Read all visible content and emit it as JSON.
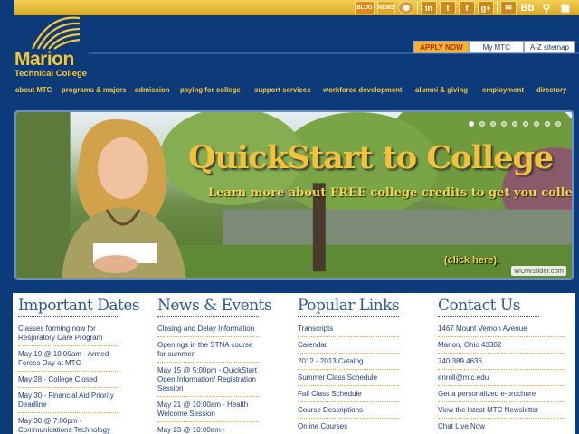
{
  "brand": {
    "name": "Marion",
    "subtitle": "Technical College"
  },
  "social_icons": [
    "blog-icon",
    "news-icon",
    "photo-icon",
    "linkedin-icon",
    "twitter-icon",
    "facebook-icon",
    "google-plus-icon",
    "email-icon",
    "blackboard-icon",
    "search-icon",
    "calendar-icon"
  ],
  "social_labels": {
    "blog": "BLOG",
    "news": "NEWS",
    "linkedin": "in",
    "twitter": "t",
    "facebook": "f",
    "blackboard": "Bb"
  },
  "utility_tabs": {
    "apply": "APPLY NOW",
    "mymtc": "My MTC",
    "az": "A-Z sitemap"
  },
  "main_nav": [
    "about MTC",
    "programs & majors",
    "admission",
    "paying for college",
    "support services",
    "workforce development",
    "alumni & giving",
    "employment",
    "directory"
  ],
  "hero": {
    "title": "QuickStart to College",
    "subline": "Learn more about FREE college credits to get you college ready",
    "click_label": "(click here).",
    "watermark": "WOWSlider.com",
    "slide_count": 9,
    "active_slide": 1
  },
  "columns": {
    "important_dates": {
      "title": "Important Dates",
      "items": [
        "Classes forming now for Respiratory Care Program",
        "May 19 @ 10:00am - Armed Forces Day at MTC",
        "May 28 - College Closed",
        "May 30 - Financial Aid Priority Deadline",
        "May 30 @ 7:00pm - Communications Technology"
      ]
    },
    "news_events": {
      "title": "News & Events",
      "items": [
        "Closing and Delay Information",
        "Openings in the STNA course for summer.",
        "May 15 @ 5:00pm - QuickStart Open Information/ Registration Session",
        "May 21 @ 10:00am - Health Welcome Session",
        "May 23 @ 10:00am -"
      ]
    },
    "popular_links": {
      "title": "Popular Links",
      "items": [
        "Transcripts",
        "Calendar",
        "2012 - 2013 Catalog",
        "Summer Class Schedule",
        "Fall Class Schedule",
        "Course Descriptions",
        "Online Courses"
      ]
    },
    "contact_us": {
      "title": "Contact Us",
      "items": [
        "1467 Mount Vernon Avenue",
        "Marion, Ohio 43302",
        "740.389.4636",
        "enroll@mtc.edu",
        "Get a personalized e-brochure",
        "View the latest MTC Newsletter",
        "Chat Live Now"
      ]
    }
  },
  "colors": {
    "navy": "#0d3a78",
    "gold": "#f5c63c",
    "link": "#1f3f7a",
    "heading": "#2a5a9a"
  }
}
